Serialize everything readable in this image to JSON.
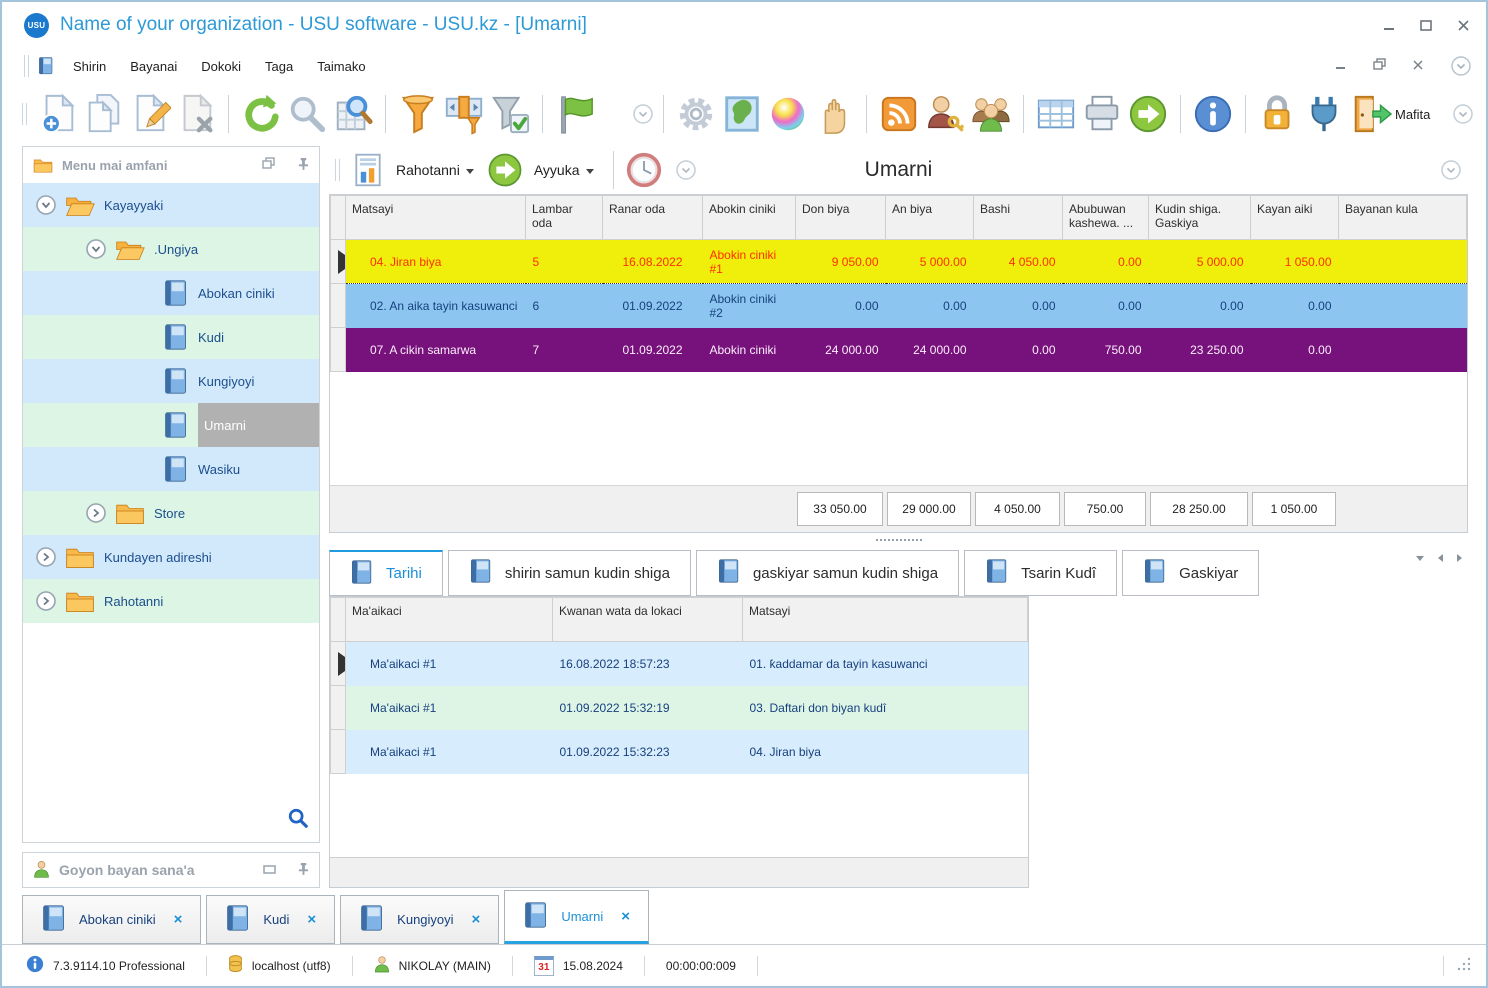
{
  "window": {
    "logo_text": "USU",
    "title": "Name of your organization - USU software - USU.kz - [Umarni]",
    "menu": [
      "Shirin",
      "Bayanai",
      "Dokoki",
      "Taga",
      "Taimako"
    ],
    "toolbar": {
      "exit_label": "Mafita",
      "icons": [
        "new-order-icon",
        "copy-icon",
        "edit-icon",
        "delete-icon",
        "refresh-icon",
        "search-icon",
        "advanced-search-icon",
        "filter-icon",
        "filter-columns-icon",
        "filter-apply-icon",
        "flag-icon",
        "overflow-chevron-icon",
        "settings-gear-icon",
        "map-icon",
        "colors-icon",
        "hand-icon",
        "rss-icon",
        "user-key-icon",
        "user-groups-icon",
        "table-view-icon",
        "print-icon",
        "go-next-icon",
        "info-icon",
        "lock-icon",
        "plug-icon",
        "exit-door-icon"
      ]
    }
  },
  "sidebar": {
    "header": "Menu mai amfani",
    "tree": [
      {
        "label": "Kayayyaki"
      },
      {
        "label": ".Ungiya"
      },
      {
        "label": "Abokan ciniki"
      },
      {
        "label": "Kudi"
      },
      {
        "label": "Kungiyoyi"
      },
      {
        "label": "Umarni"
      },
      {
        "label": "Wasiku"
      },
      {
        "label": "Store"
      },
      {
        "label": "Kundayen adireshi"
      },
      {
        "label": "Rahotanni"
      }
    ],
    "support_panel": "Goyon bayan sana'a"
  },
  "panel": {
    "title": "Umarni",
    "reports_button": "Rahotanni",
    "actions_button": "Ayyuka"
  },
  "main_table": {
    "headers": [
      "Matsayi",
      "Lambar oda",
      "Ranar oda",
      "Abokin ciniki",
      "Don biya",
      "An biya",
      "Bashi",
      "Abubuwan kashewa. ...",
      "Kudin shiga. Gaskiya",
      "Kayan aiki",
      "Bayanan kula"
    ],
    "rows": [
      {
        "matsayi": "04. Jiran biya",
        "lambar": "5",
        "ranar": "16.08.2022",
        "abokin": "Abokin ciniki #1",
        "don_biya": "9 050.00",
        "an_biya": "5 000.00",
        "bashi": "4 050.00",
        "abubuwan": "0.00",
        "kudin_shiga": "5 000.00",
        "kayan_aiki": "1 050.00",
        "bayanan": ""
      },
      {
        "matsayi": "02. An aika tayin kasuwanci",
        "lambar": "6",
        "ranar": "01.09.2022",
        "abokin": "Abokin ciniki #2",
        "don_biya": "0.00",
        "an_biya": "0.00",
        "bashi": "0.00",
        "abubuwan": "0.00",
        "kudin_shiga": "0.00",
        "kayan_aiki": "0.00",
        "bayanan": ""
      },
      {
        "matsayi": "07. A cikin samarwa",
        "lambar": "7",
        "ranar": "01.09.2022",
        "abokin": "Abokin ciniki",
        "don_biya": "24 000.00",
        "an_biya": "24 000.00",
        "bashi": "0.00",
        "abubuwan": "750.00",
        "kudin_shiga": "23 250.00",
        "kayan_aiki": "0.00",
        "bayanan": ""
      }
    ],
    "totals": {
      "don_biya": "33 050.00",
      "an_biya": "29 000.00",
      "bashi": "4 050.00",
      "abubuwan": "750.00",
      "kudin_shiga": "28 250.00",
      "kayan_aiki": "1 050.00"
    }
  },
  "detail_tabs": [
    "Tarihi",
    "shirin samun kudin shiga",
    "gaskiyar samun kudin shiga",
    "Tsarin Kudî",
    "Gaskiyar"
  ],
  "history_table": {
    "headers": [
      "Ma'aikaci",
      "Kwanan wata da lokaci",
      "Matsayi"
    ],
    "rows": [
      [
        "Ma'aikaci #1",
        "16.08.2022 18:57:23",
        "01. ƙaddamar da tayin kasuwanci"
      ],
      [
        "Ma'aikaci #1",
        "01.09.2022 15:32:19",
        "03. Daftari don biyan kudî"
      ],
      [
        "Ma'aikaci #1",
        "01.09.2022 15:32:23",
        "04. Jiran biya"
      ]
    ]
  },
  "window_tabs": [
    {
      "label": "Abokan ciniki"
    },
    {
      "label": "Kudi"
    },
    {
      "label": "Kungiyoyi"
    },
    {
      "label": "Umarni"
    }
  ],
  "statusbar": {
    "version": "7.3.9114.10 Professional",
    "database": "localhost (utf8)",
    "user": "NIKOLAY (MAIN)",
    "calendar_day": "31",
    "date": "15.08.2024",
    "timer": "00:00:00:009"
  },
  "colors": {
    "accent_blue": "#1f9ce0",
    "title_blue": "#2d9ad8",
    "row_yellow": "#f0ee0b",
    "row_yellow_text": "#ff2f00",
    "row_blue": "#8cc6f0",
    "row_purple": "#77117b",
    "tree_blue": "#d2e9fc",
    "tree_green": "#dcf5e4",
    "selected_gray": "#b1b1b1"
  }
}
